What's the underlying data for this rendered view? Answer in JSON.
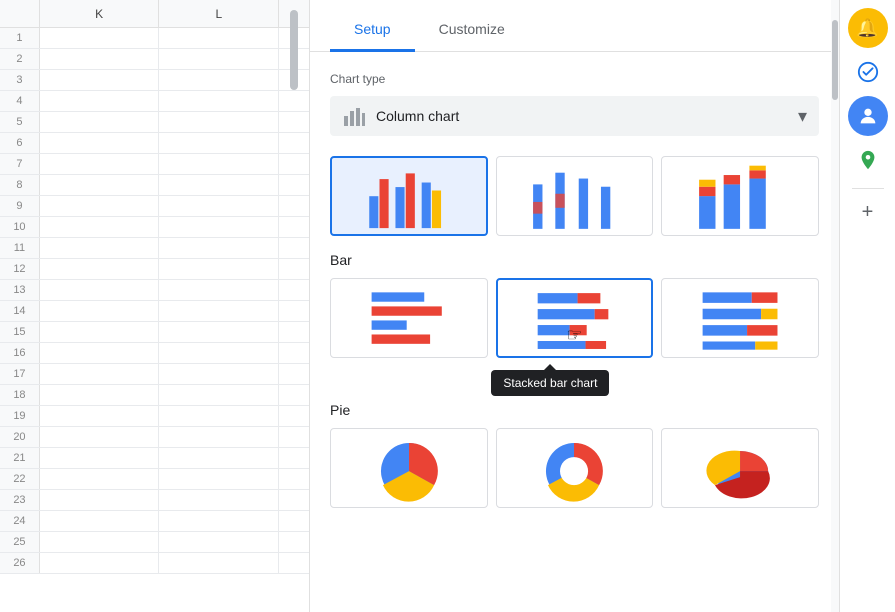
{
  "spreadsheet": {
    "columns": [
      "K",
      "L"
    ],
    "row_count": 26
  },
  "editor": {
    "tabs": [
      {
        "label": "Setup",
        "active": true
      },
      {
        "label": "Customize",
        "active": false
      }
    ],
    "chart_type_label": "Chart type",
    "dropdown": {
      "label": "Column chart",
      "icon": "column-chart-icon"
    },
    "sections": {
      "column": {
        "title": ""
      },
      "bar": {
        "title": "Bar"
      },
      "pie": {
        "title": "Pie"
      }
    },
    "tooltip": {
      "text": "Stacked bar chart"
    }
  },
  "right_sidebar": {
    "icons": [
      {
        "name": "notifications-icon",
        "symbol": "🔔",
        "style": "yellow"
      },
      {
        "name": "tasks-icon",
        "symbol": "✔",
        "style": "blue-outline"
      },
      {
        "name": "contacts-icon",
        "symbol": "👤",
        "style": "blue"
      },
      {
        "name": "maps-icon",
        "symbol": "📍",
        "style": "plain"
      }
    ],
    "plus_label": "+"
  }
}
